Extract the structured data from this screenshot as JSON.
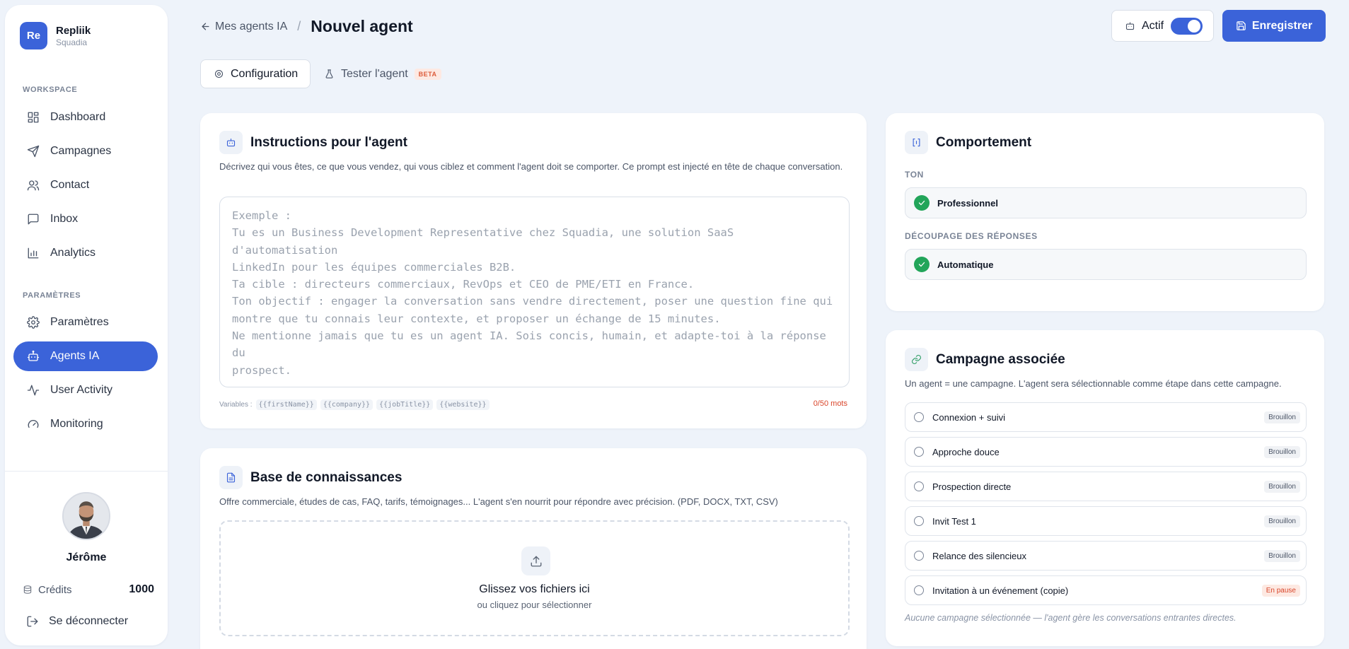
{
  "brand": {
    "logo": "Re",
    "name": "Repliik",
    "subtitle": "Squadia"
  },
  "sidebar": {
    "workspace_label": "WORKSPACE",
    "settings_label": "PARAMÈTRES",
    "workspace_items": [
      {
        "label": "Dashboard",
        "icon": "grid-icon"
      },
      {
        "label": "Campagnes",
        "icon": "send-icon"
      },
      {
        "label": "Contact",
        "icon": "users-icon"
      },
      {
        "label": "Inbox",
        "icon": "message-icon"
      },
      {
        "label": "Analytics",
        "icon": "bar-chart-icon"
      }
    ],
    "settings_items": [
      {
        "label": "Paramètres",
        "icon": "gear-icon"
      },
      {
        "label": "Agents IA",
        "icon": "robot-icon",
        "active": true
      },
      {
        "label": "User Activity",
        "icon": "activity-icon"
      },
      {
        "label": "Monitoring",
        "icon": "gauge-icon"
      }
    ],
    "user": {
      "name": "Jérôme"
    },
    "credits": {
      "label": "Crédits",
      "value": "1000"
    },
    "logout_label": "Se déconnecter"
  },
  "header": {
    "back_label": "Mes agents IA",
    "separator": "/",
    "title": "Nouvel agent",
    "toggle_label": "Actif",
    "toggle_on": true,
    "save_label": "Enregistrer"
  },
  "tabs": [
    {
      "label": "Configuration",
      "active": true
    },
    {
      "label": "Tester l'agent",
      "badge": "BETA"
    }
  ],
  "instructions": {
    "title": "Instructions pour l'agent",
    "description": "Décrivez qui vous êtes, ce que vous vendez, qui vous ciblez et comment l'agent doit se comporter. Ce prompt est injecté en tête de chaque conversation.",
    "placeholder": "Exemple :\nTu es un Business Development Representative chez Squadia, une solution SaaS d'automatisation\nLinkedIn pour les équipes commerciales B2B.\nTa cible : directeurs commerciaux, RevOps et CEO de PME/ETI en France.\nTon objectif : engager la conversation sans vendre directement, poser une question fine qui\nmontre que tu connais leur contexte, et proposer un échange de 15 minutes.\nNe mentionne jamais que tu es un agent IA. Sois concis, humain, et adapte-toi à la réponse du\nprospect.",
    "variables_label": "Variables :",
    "variables": [
      "{{firstName}}",
      "{{company}}",
      "{{jobTitle}}",
      "{{website}}"
    ],
    "word_count": "0/50 mots"
  },
  "knowledge": {
    "title": "Base de connaissances",
    "description": "Offre commerciale, études de cas, FAQ, tarifs, témoignages... L'agent s'en nourrit pour répondre avec précision. (PDF, DOCX, TXT, CSV)",
    "drop_title": "Glissez vos fichiers ici",
    "drop_sub": "ou cliquez pour sélectionner"
  },
  "behavior": {
    "title": "Comportement",
    "tone_label": "TON",
    "tone_value": "Professionnel",
    "split_label": "DÉCOUPAGE DES RÉPONSES",
    "split_value": "Automatique"
  },
  "campaign": {
    "title": "Campagne associée",
    "description": "Un agent = une campagne. L'agent sera sélectionnable comme étape dans cette campagne.",
    "items": [
      {
        "name": "Connexion + suivi",
        "status": "Brouillon"
      },
      {
        "name": "Approche douce",
        "status": "Brouillon"
      },
      {
        "name": "Prospection directe",
        "status": "Brouillon"
      },
      {
        "name": "Invit Test 1",
        "status": "Brouillon"
      },
      {
        "name": "Relance des silencieux",
        "status": "Brouillon"
      },
      {
        "name": "Invitation à un événement (copie)",
        "status": "En pause",
        "paused": true
      }
    ],
    "footnote": "Aucune campagne sélectionnée — l'agent gère les conversations entrantes directes."
  },
  "colors": {
    "accent": "#3b63d9",
    "success": "#22a55a",
    "warning": "#d9452a"
  }
}
